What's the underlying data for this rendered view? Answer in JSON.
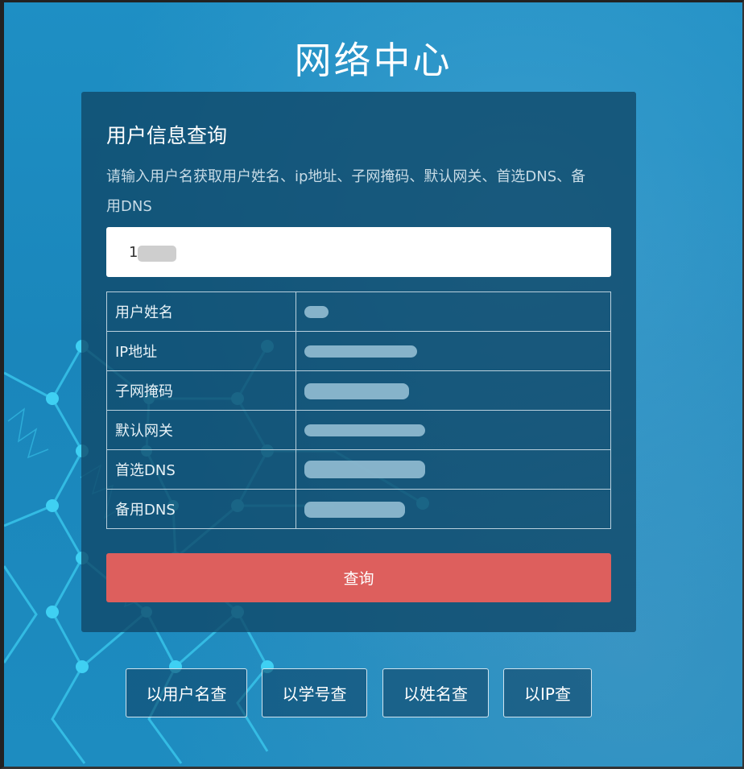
{
  "page": {
    "title": "网络中心"
  },
  "card": {
    "title": "用户信息查询",
    "description": "请输入用户名获取用户姓名、ip地址、子网掩码、默认网关、首选DNS、备用DNS"
  },
  "search": {
    "value": "1"
  },
  "info_table": {
    "rows": [
      {
        "label": "用户姓名"
      },
      {
        "label": "IP地址"
      },
      {
        "label": "子网掩码"
      },
      {
        "label": "默认网关"
      },
      {
        "label": "首选DNS"
      },
      {
        "label": "备用DNS"
      }
    ]
  },
  "query_button": {
    "label": "查询"
  },
  "modes": [
    {
      "label": "以用户名查"
    },
    {
      "label": "以学号查"
    },
    {
      "label": "以姓名查"
    },
    {
      "label": "以IP查"
    }
  ],
  "colors": {
    "accent": "#dd5f5d",
    "card": "#104666",
    "background": "#1e8fc4"
  }
}
